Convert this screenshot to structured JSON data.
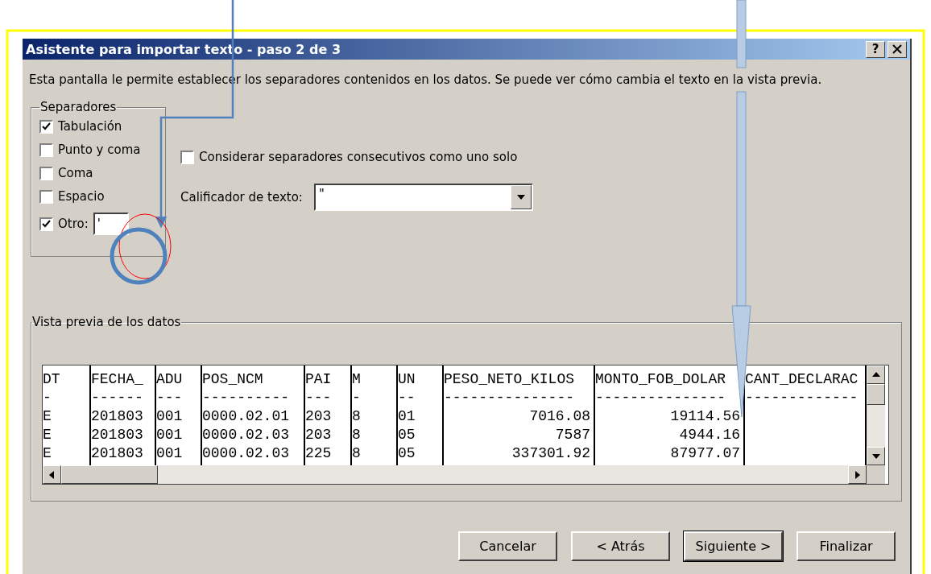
{
  "window": {
    "title": "Asistente para importar texto - paso 2 de 3",
    "help_button": "?"
  },
  "description": "Esta pantalla le permite establecer los separadores contenidos en los datos. Se puede ver cómo cambia el texto en la vista previa.",
  "separators": {
    "legend": "Separadores",
    "items": [
      {
        "label": "Tabulación",
        "checked": true
      },
      {
        "label": "Punto y coma",
        "checked": false
      },
      {
        "label": "Coma",
        "checked": false
      },
      {
        "label": "Espacio",
        "checked": false
      },
      {
        "label": "Otro:",
        "checked": true
      }
    ],
    "other_value": "'"
  },
  "consecutive": {
    "label": "Considerar separadores consecutivos como uno solo",
    "checked": false
  },
  "text_qualifier": {
    "label": "Calificador de texto:",
    "value": "\""
  },
  "preview": {
    "legend": "Vista previa de los datos",
    "columns": [
      {
        "header": "DT",
        "dashes": "-",
        "kind": "text"
      },
      {
        "header": "FECHA_",
        "dashes": "------",
        "kind": "text"
      },
      {
        "header": "ADU",
        "dashes": "---",
        "kind": "text"
      },
      {
        "header": "POS_NCM",
        "dashes": "----------",
        "kind": "text"
      },
      {
        "header": "PAI",
        "dashes": "---",
        "kind": "text"
      },
      {
        "header": "M",
        "dashes": "-",
        "kind": "text"
      },
      {
        "header": "UN",
        "dashes": "--",
        "kind": "text"
      },
      {
        "header": "PESO_NETO_KILOS",
        "dashes": "---------------",
        "kind": "number"
      },
      {
        "header": "MONTO_FOB_DOLAR",
        "dashes": "---------------",
        "kind": "number"
      },
      {
        "header": "CANT_DECLARAC",
        "dashes": "-------------",
        "kind": "number"
      }
    ],
    "rows": [
      [
        "E",
        "201803",
        "001",
        "0000.02.01",
        "203",
        "8",
        "01",
        "7016.08",
        "19114.56",
        ""
      ],
      [
        "E",
        "201803",
        "001",
        "0000.02.03",
        "203",
        "8",
        "05",
        "7587",
        "4944.16",
        ""
      ],
      [
        "E",
        "201803",
        "001",
        "0000.02.03",
        "225",
        "8",
        "05",
        "337301.92",
        "87977.07",
        ""
      ]
    ]
  },
  "buttons": [
    {
      "label": "Cancelar",
      "default": false
    },
    {
      "label": "< Atrás",
      "default": false
    },
    {
      "label": "Siguiente >",
      "default": true
    },
    {
      "label": "Finalizar",
      "default": false
    }
  ]
}
